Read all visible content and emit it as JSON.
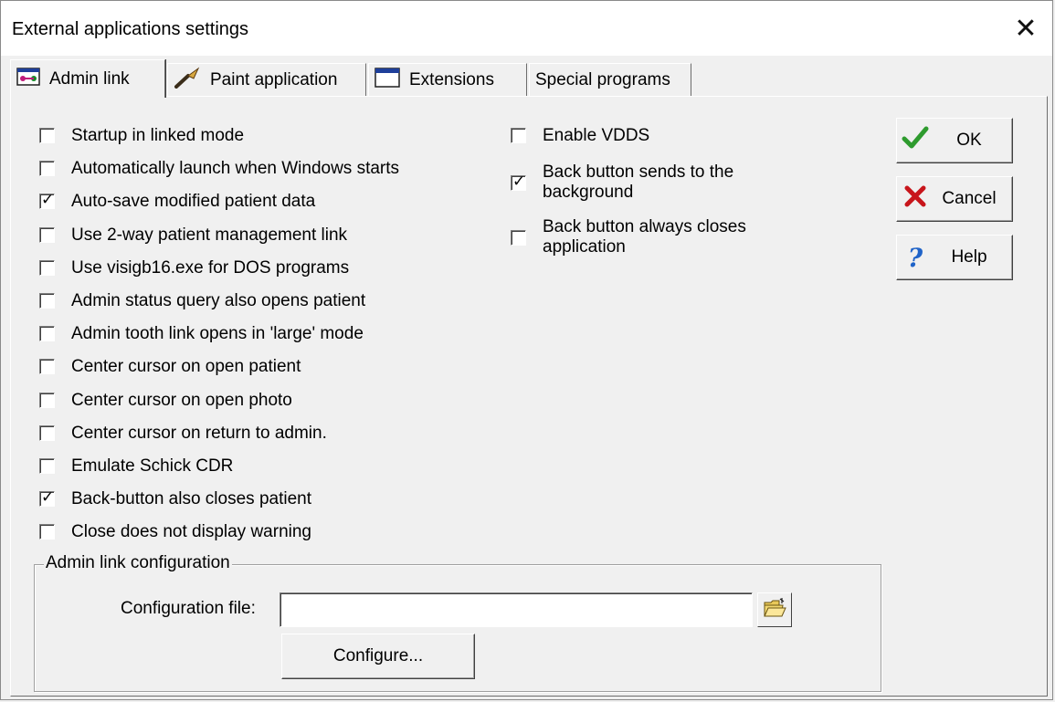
{
  "window": {
    "title": "External applications settings",
    "close_glyph": "✕"
  },
  "tabs": [
    {
      "label": "Admin link",
      "icon": "admin-link-icon",
      "active": true
    },
    {
      "label": "Paint application",
      "icon": "paintbrush-icon",
      "active": false
    },
    {
      "label": "Extensions",
      "icon": "window-icon",
      "active": false
    },
    {
      "label": "Special programs",
      "icon": "",
      "active": false
    }
  ],
  "options_left": [
    {
      "label": "Startup in linked mode",
      "checked": false
    },
    {
      "label": "Automatically launch when Windows starts",
      "checked": false
    },
    {
      "label": "Auto-save modified patient data",
      "checked": true
    },
    {
      "label": "Use 2-way patient management link",
      "checked": false
    },
    {
      "label": "Use visigb16.exe for DOS programs",
      "checked": false
    },
    {
      "label": "Admin status query also opens patient",
      "checked": false
    },
    {
      "label": "Admin tooth link opens in 'large' mode",
      "checked": false
    },
    {
      "label": "Center cursor on open patient",
      "checked": false
    },
    {
      "label": "Center cursor on open photo",
      "checked": false
    },
    {
      "label": "Center cursor on return to admin.",
      "checked": false
    },
    {
      "label": "Emulate Schick CDR",
      "checked": false
    },
    {
      "label": "Back-button also closes patient",
      "checked": true
    },
    {
      "label": "Close does not display warning",
      "checked": false
    }
  ],
  "options_right": [
    {
      "label_lines": [
        "Enable VDDS"
      ],
      "checked": false
    },
    {
      "label_lines": [
        "Back button sends to the",
        "background"
      ],
      "checked": true
    },
    {
      "label_lines": [
        "Back button always closes",
        "application"
      ],
      "checked": false
    }
  ],
  "buttons": {
    "ok": "OK",
    "cancel": "Cancel",
    "help": "Help"
  },
  "admin_link_group": {
    "legend": "Admin link configuration",
    "config_file_label": "Configuration file:",
    "config_file_value": "",
    "configure_button": "Configure..."
  },
  "colors": {
    "ok_check": "#2e9b2e",
    "cancel_x": "#c8151b",
    "help_q": "#1f63c8"
  },
  "check_glyph": "✓"
}
